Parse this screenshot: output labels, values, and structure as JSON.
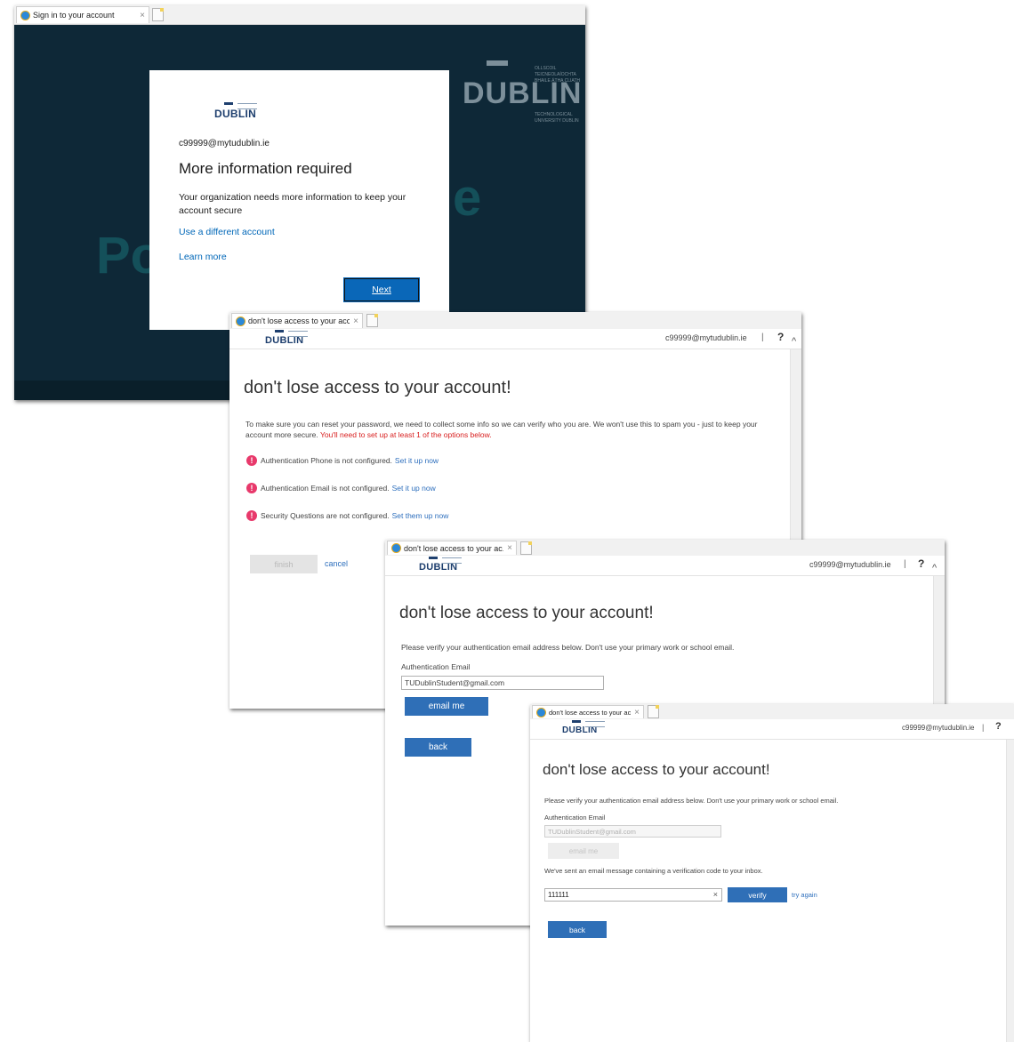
{
  "brand": {
    "logo_text": "DUBLIN",
    "bg_wordmark": "DUBLIN",
    "bg_subtitle_1": "OLLSCOIL TEICNEOLAÍOCHTA BHAILE ÁTHA CLIATH",
    "bg_subtitle_2": "TECHNOLOGICAL UNIVERSITY DUBLIN",
    "bg_word_left": "Po",
    "bg_word_right": "e",
    "colors": {
      "navy": "#0e2837",
      "link_blue": "#0067b8",
      "button_blue": "#2f6fb7",
      "error_pink": "#e8396b",
      "warning_red": "#d81e1e"
    }
  },
  "signin": {
    "tab_title": "Sign in to your account",
    "email": "c99999@mytudublin.ie",
    "heading": "More information required",
    "description": "Your organization needs more information to keep your account secure",
    "link_different_account": "Use a different account",
    "link_learn_more": "Learn more",
    "next_label": "Next"
  },
  "setup": {
    "tab_title": "don't lose access to your acc...",
    "user": "c99999@mytudublin.ie",
    "separator": "|",
    "help": "?",
    "chevron": "^",
    "title": "don't lose access to your account!",
    "intro": "To make sure you can reset your password, we need to collect some info so we can verify who you are. We won't use this to spam you - just to keep your account more secure.",
    "intro_warning": "You'll need to set up at least 1 of the options below.",
    "items": [
      {
        "text": "Authentication Phone is not configured.",
        "link": "Set it up now"
      },
      {
        "text": "Authentication Email is not configured.",
        "link": "Set it up now"
      },
      {
        "text": "Security Questions are not configured.",
        "link": "Set them up now"
      }
    ],
    "finish_label": "finish",
    "cancel_label": "cancel"
  },
  "email_verify": {
    "tab_title": "don't lose access to your ac...",
    "user": "c99999@mytudublin.ie",
    "separator": "|",
    "help": "?",
    "chevron": "^",
    "title": "don't lose access to your account!",
    "instructions": "Please verify your authentication email address below. Don't use your primary work or school email.",
    "field_label": "Authentication Email",
    "field_value": "TUDublinStudent@gmail.com",
    "email_me_label": "email me",
    "back_label": "back"
  },
  "code_verify": {
    "tab_title": "don't lose access to your ac...",
    "user": "c99999@mytudublin.ie",
    "separator": "|",
    "help": "?",
    "title": "don't lose access to your account!",
    "instructions": "Please verify your authentication email address below. Don't use your primary work or school email.",
    "field_label": "Authentication Email",
    "field_value": "TUDublinStudent@gmail.com",
    "email_me_label": "email me",
    "sent_message": "We've sent an email message containing a verification code to your inbox.",
    "code_value": "111111",
    "clear_label": "×",
    "verify_label": "verify",
    "try_again_label": "try again",
    "back_label": "back"
  }
}
